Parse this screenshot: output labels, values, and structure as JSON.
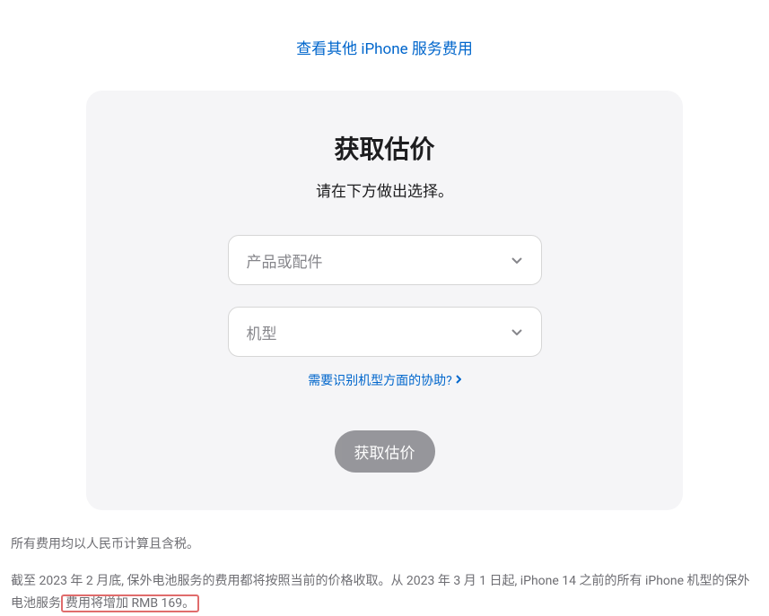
{
  "topLink": {
    "label": "查看其他 iPhone 服务费用"
  },
  "card": {
    "title": "获取估价",
    "subtitle": "请在下方做出选择。",
    "select1": {
      "placeholder": "产品或配件"
    },
    "select2": {
      "placeholder": "机型"
    },
    "helpLink": {
      "label": "需要识别机型方面的协助?"
    },
    "submitLabel": "获取估价"
  },
  "footer": {
    "line1": "所有费用均以人民币计算且含税。",
    "line2_pre": "截至 2023 年 2 月底, 保外电池服务的费用都将按照当前的价格收取。从 2023 年 3 月 1 日起, iPhone 14 之前的所有 iPhone 机型的保外电池服务",
    "line2_highlight": "费用将增加 RMB 169。"
  }
}
